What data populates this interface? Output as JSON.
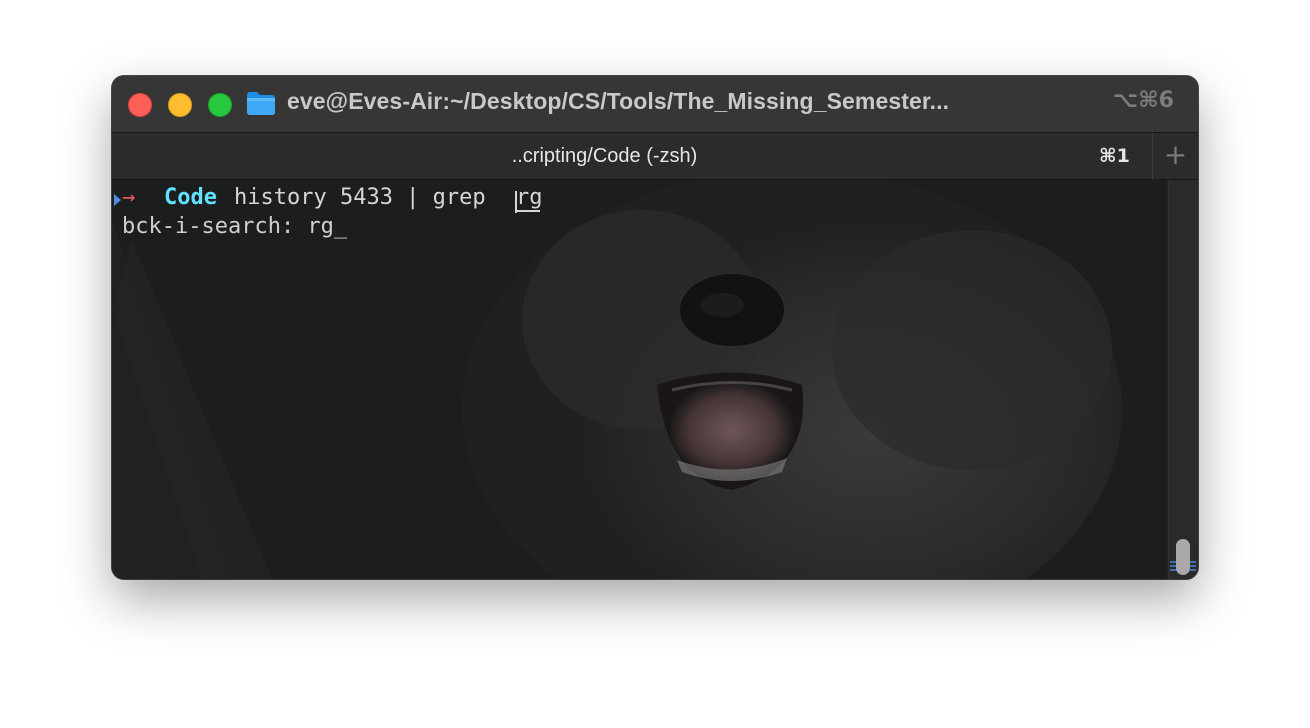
{
  "window": {
    "title": "eve@Eves-Air:~/Desktop/CS/Tools/The_Missing_Semester...",
    "title_shortcut": "⌥⌘6"
  },
  "tab": {
    "label": "..cripting/Code (-zsh)",
    "shortcut": "⌘1",
    "new_tab_symbol": "+"
  },
  "terminal": {
    "prompt_symbol": "→",
    "directory": "Code",
    "command": "history 5433 | grep ",
    "search_term": "rg",
    "search_line": "bck-i-search: rg_",
    "colors": {
      "prompt_arrow": "#e05a5a",
      "directory": "#5fe3ff",
      "text": "#d6d6d6",
      "background": "#1c1d1e"
    }
  },
  "icons": {
    "folder": "folder-icon",
    "close": "close-icon",
    "minimize": "minimize-icon",
    "zoom": "zoom-icon",
    "add": "plus-icon"
  }
}
